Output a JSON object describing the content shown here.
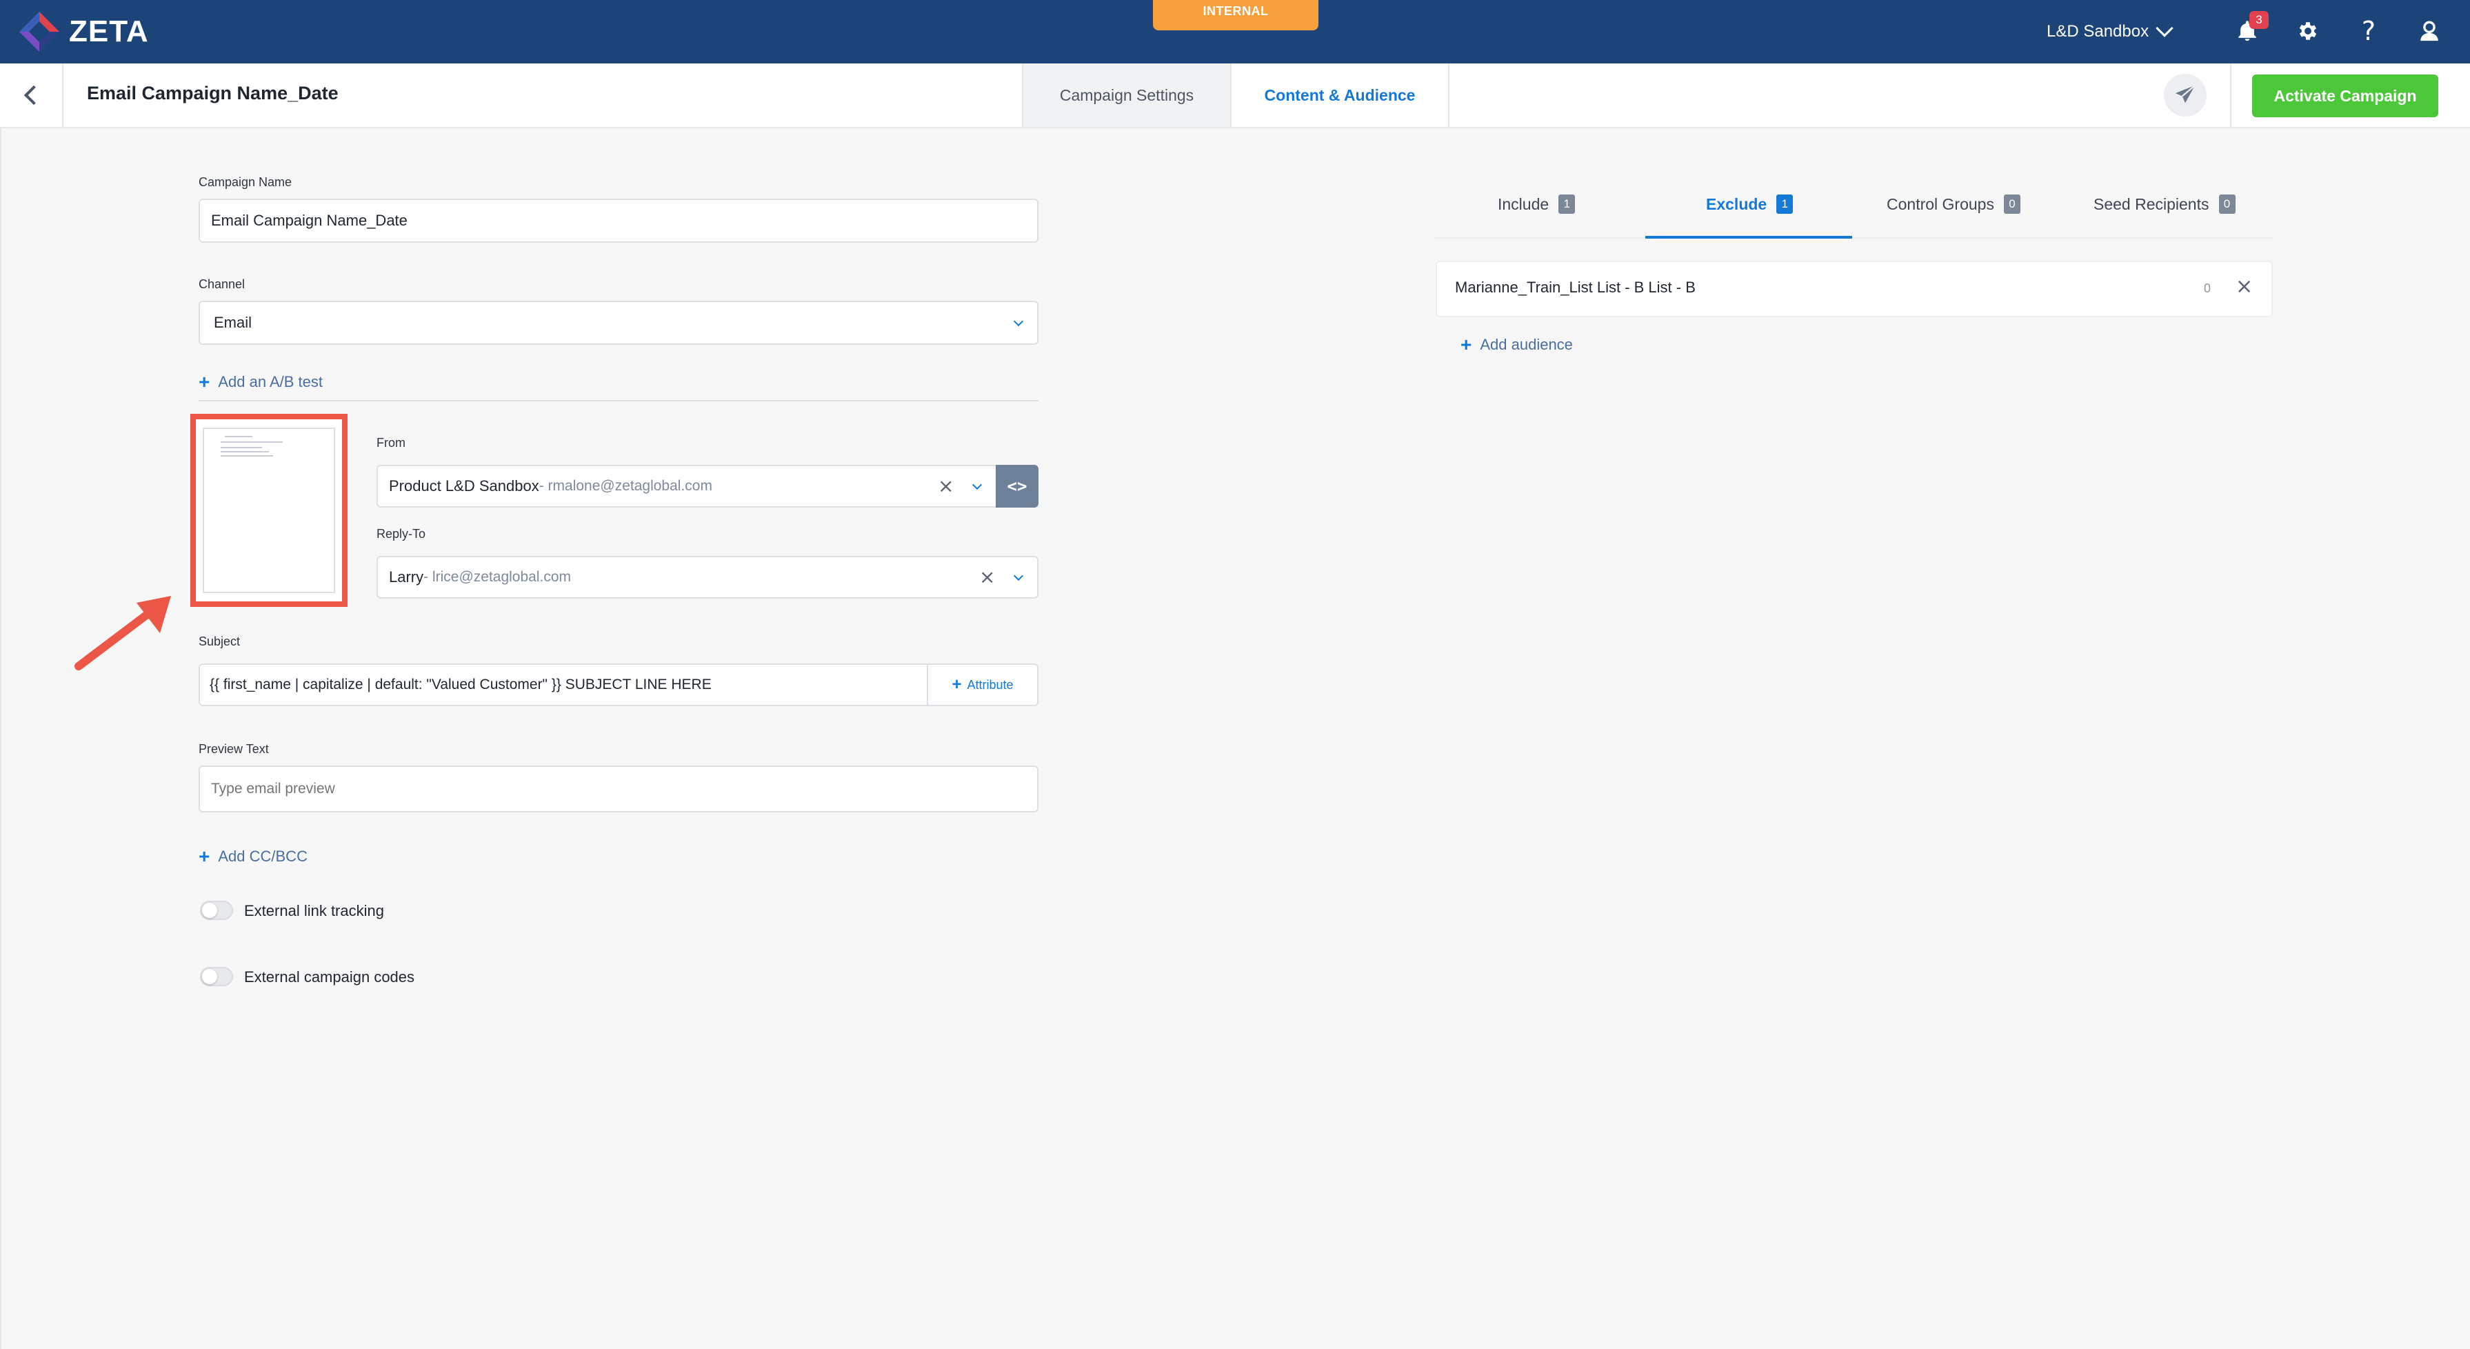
{
  "brand": {
    "name": "ZETA",
    "nav_color": "#1d4479",
    "accent": "#1479d6",
    "success": "#4cc73a",
    "highlight": "#ec5646"
  },
  "env_badge": "INTERNAL",
  "org_switcher": {
    "label": "L&D Sandbox"
  },
  "notifications": {
    "count": "3"
  },
  "icons": [
    "zeta-logo-icon",
    "chevron-down-icon",
    "bell-icon",
    "gear-icon",
    "help-icon",
    "user-icon",
    "back-arrow-icon",
    "send-icon",
    "code-icon",
    "plus-icon",
    "close-icon"
  ],
  "header": {
    "title": "Email Campaign Name_Date",
    "tabs": [
      {
        "label": "Campaign Settings",
        "active": false
      },
      {
        "label": "Content & Audience",
        "active": true
      }
    ],
    "activate_label": "Activate Campaign"
  },
  "form": {
    "campaign_name": {
      "label": "Campaign Name",
      "value": "Email Campaign Name_Date"
    },
    "channel": {
      "label": "Channel",
      "value": "Email"
    },
    "ab_test_label": "Add an A/B test",
    "from": {
      "label": "From",
      "name": "Product L&D Sandbox",
      "email": " - rmalone@zetaglobal.com"
    },
    "reply_to": {
      "label": "Reply-To",
      "name": "Larry",
      "email": " - lrice@zetaglobal.com"
    },
    "subject": {
      "label": "Subject",
      "value": "{{ first_name | capitalize | default: \"Valued Customer\" }} SUBJECT LINE HERE",
      "attribute_label": "Attribute"
    },
    "preview_text": {
      "label": "Preview Text",
      "placeholder": "Type email preview"
    },
    "cc_bcc_label": "Add CC/BCC",
    "external_link_tracking": {
      "label": "External link tracking",
      "enabled": false
    },
    "external_campaign_codes": {
      "label": "External campaign codes",
      "enabled": false
    }
  },
  "audience": {
    "tabs": [
      {
        "label": "Include",
        "count": "1",
        "active": false
      },
      {
        "label": "Exclude",
        "count": "1",
        "active": true
      },
      {
        "label": "Control Groups",
        "count": "0",
        "active": false
      },
      {
        "label": "Seed Recipients",
        "count": "0",
        "active": false
      }
    ],
    "items": [
      {
        "name": "Marianne_Train_List List - B List - B",
        "count": "0"
      }
    ],
    "add_label": "Add audience"
  }
}
